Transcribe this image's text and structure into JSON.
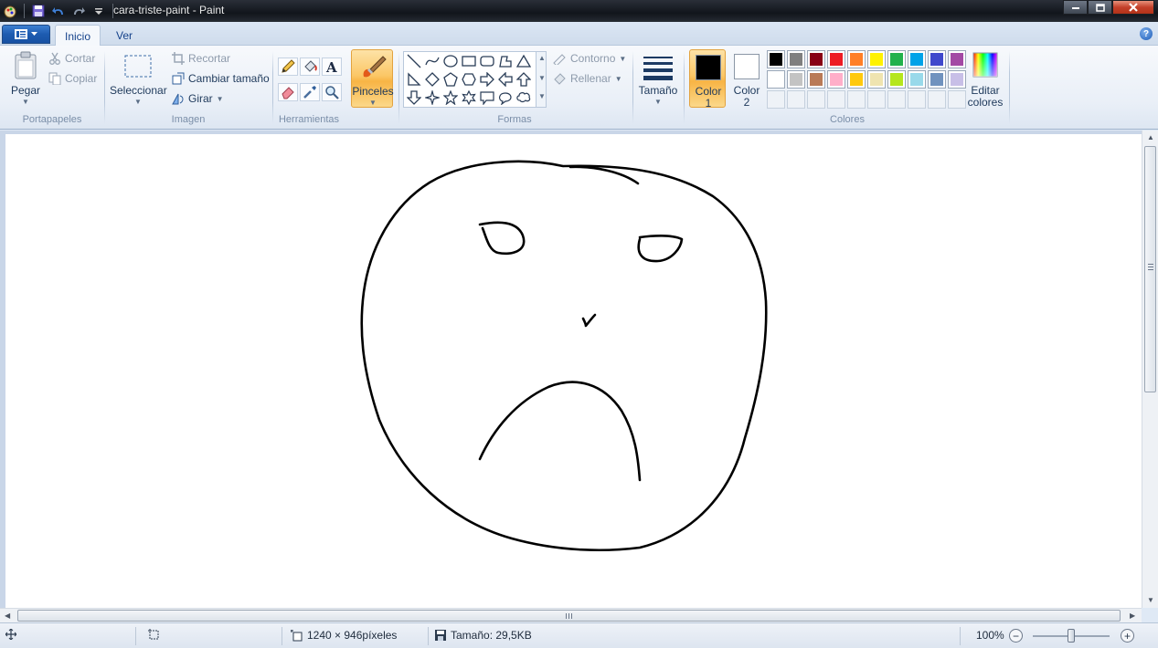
{
  "window": {
    "title": "cara-triste-paint - Paint"
  },
  "tabs": {
    "home": "Inicio",
    "view": "Ver"
  },
  "clipboard": {
    "paste": "Pegar",
    "cut": "Cortar",
    "copy": "Copiar",
    "group": "Portapapeles"
  },
  "image": {
    "select": "Seleccionar",
    "crop": "Recortar",
    "resize": "Cambiar tamaño",
    "rotate": "Girar",
    "group": "Imagen"
  },
  "tools": {
    "group": "Herramientas",
    "items": [
      "pencil-icon",
      "fill-bucket-icon",
      "text-icon",
      "eraser-icon",
      "color-picker-icon",
      "magnifier-icon"
    ]
  },
  "brushes": {
    "label": "Pinceles"
  },
  "shapes": {
    "group": "Formas",
    "outline": "Contorno",
    "fill": "Rellenar"
  },
  "size": {
    "label": "Tamaño"
  },
  "colors": {
    "color1_label": "Color",
    "color1_num": "1",
    "color2_label": "Color",
    "color2_num": "2",
    "color1": "#000000",
    "color2": "#ffffff",
    "edit_label_1": "Editar",
    "edit_label_2": "colores",
    "group": "Colores",
    "palette_row1": [
      "#000000",
      "#7f7f7f",
      "#880015",
      "#ed1c24",
      "#ff7f27",
      "#fff200",
      "#22b14c",
      "#00a2e8",
      "#3f48cc",
      "#a349a4"
    ],
    "palette_row2": [
      "#ffffff",
      "#c3c3c3",
      "#b97a57",
      "#ffaec9",
      "#ffc90e",
      "#efe4b0",
      "#b5e61d",
      "#99d9ea",
      "#7092be",
      "#c8bfe7"
    ]
  },
  "status": {
    "dimensions": "1240 × 946píxeles",
    "filesize": "Tamaño: 29,5KB",
    "zoom": "100%",
    "zoom_fraction": 0.5
  },
  "accent": {
    "active_button": "#fbc766",
    "ribbon_blue": "#1d5bb0"
  }
}
